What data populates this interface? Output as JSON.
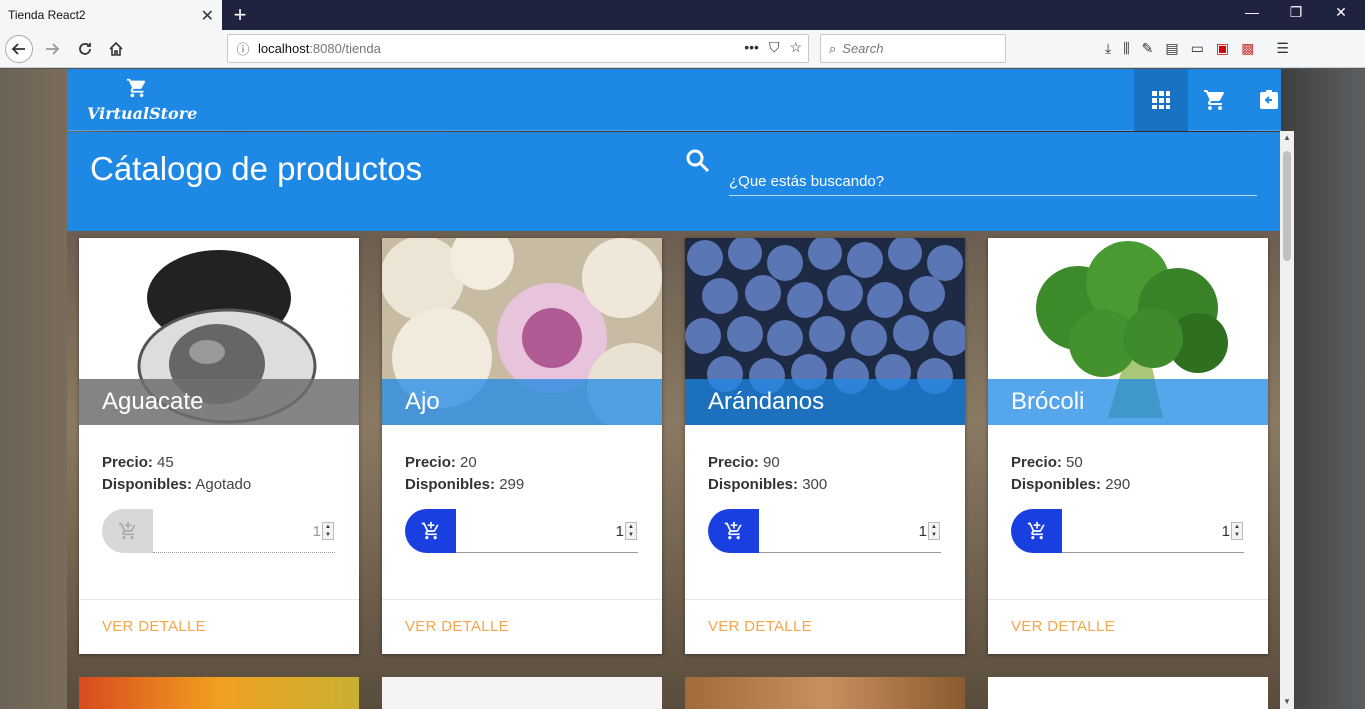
{
  "browser": {
    "tab_title": "Tienda React2",
    "tab_close": "✕",
    "new_tab": "+",
    "url_host": "localhost",
    "url_path": ":8080/tienda",
    "url_more": "•••",
    "search_placeholder": "Search",
    "window_controls": [
      "—",
      "❐",
      "✕"
    ]
  },
  "app": {
    "logo_text": "VirtualStore",
    "catalog_title": "Cátalogo de productos",
    "search_placeholder": "¿Que estás buscando?"
  },
  "labels": {
    "price": "Precio:",
    "available": "Disponibles:",
    "action": "VER DETALLE"
  },
  "products": [
    {
      "name": "Aguacate",
      "price": "45",
      "available": "Agotado",
      "qty": "1",
      "enabled": false
    },
    {
      "name": "Ajo",
      "price": "20",
      "available": "299",
      "qty": "1",
      "enabled": true
    },
    {
      "name": "Arándanos",
      "price": "90",
      "available": "300",
      "qty": "1",
      "enabled": true
    },
    {
      "name": "Brócoli",
      "price": "50",
      "available": "290",
      "qty": "1",
      "enabled": true
    }
  ],
  "colors": {
    "primary": "#1e88e5",
    "button_active": "#1a3fe0",
    "button_disabled": "#d8d8d8",
    "action_text": "#f5a64a"
  }
}
